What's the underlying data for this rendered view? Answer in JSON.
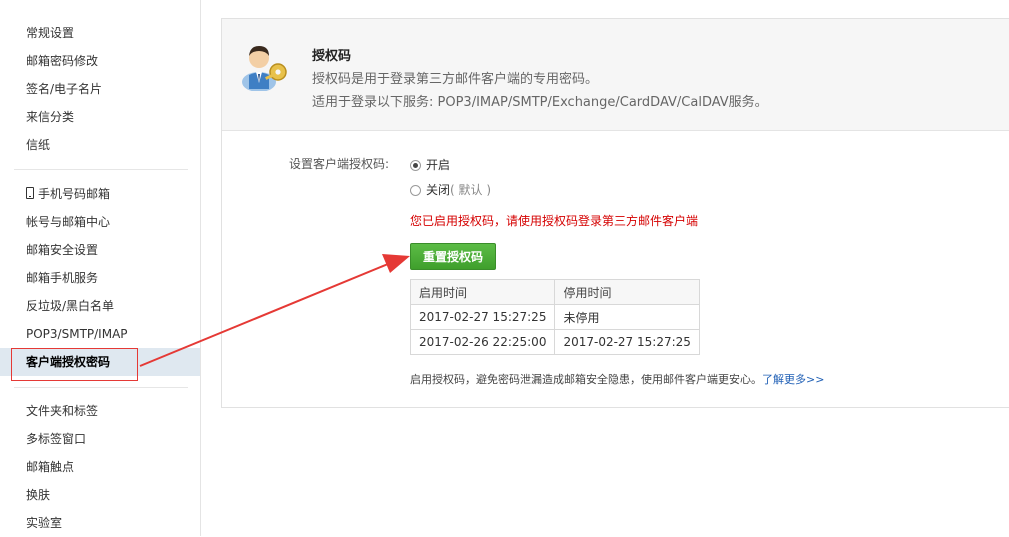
{
  "sidebar": {
    "group1": [
      "常规设置",
      "邮箱密码修改",
      "签名/电子名片",
      "来信分类",
      "信纸"
    ],
    "group2": [
      "手机号码邮箱",
      "帐号与邮箱中心",
      "邮箱安全设置",
      "邮箱手机服务",
      "反垃圾/黑白名单",
      "POP3/SMTP/IMAP",
      "客户端授权密码"
    ],
    "group3": [
      "文件夹和标签",
      "多标签窗口",
      "邮箱触点",
      "换肤",
      "实验室"
    ],
    "active": "客户端授权密码"
  },
  "header": {
    "icon": "user-key-icon",
    "title": "授权码",
    "desc1": "授权码是用于登录第三方邮件客户端的专用密码。",
    "desc2": "适用于登录以下服务: POP3/IMAP/SMTP/Exchange/CardDAV/CalDAV服务。"
  },
  "form": {
    "label": "设置客户端授权码:",
    "option_on": "开启",
    "option_off": "关闭",
    "option_off_note": "( 默认 )",
    "selected": "on",
    "notice": "您已启用授权码，请使用授权码登录第三方邮件客户端",
    "reset_button": "重置授权码"
  },
  "table": {
    "headers": [
      "启用时间",
      "停用时间"
    ],
    "rows": [
      [
        "2017-02-27 15:27:25",
        "未停用"
      ],
      [
        "2017-02-26 22:25:00",
        "2017-02-27 15:27:25"
      ]
    ]
  },
  "footer": {
    "tip": "启用授权码，避免密码泄漏造成邮箱安全隐患，使用邮件客户端更安心。",
    "link": "了解更多>>"
  },
  "colors": {
    "accent_green": "#4caf37",
    "notice_red": "#d50000",
    "annotation_red": "#e53935",
    "link_blue": "#1f5fb5"
  }
}
